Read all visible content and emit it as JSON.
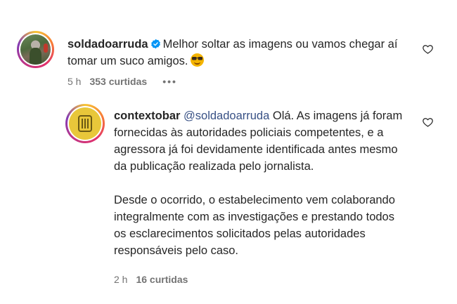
{
  "comments": [
    {
      "username": "soldadoarruda",
      "verified": true,
      "text": "Melhor soltar as imagens ou vamos chegar aí tomar um suco amigos.",
      "emoji": "sunglasses-emoji",
      "time": "5 h",
      "likes": "353 curtidas",
      "more": "•••"
    },
    {
      "username": "contextobar",
      "mention": "@soldadoarruda",
      "paragraph1": "Olá. As imagens já foram fornecidas às autoridades policiais competentes, e a agressora já foi devidamente identificada antes mesmo da publicação realizada pelo jornalista.",
      "paragraph2": "Desde o ocorrido, o estabelecimento vem colaborando integralmente com as investigações e prestando todos os esclarecimentos solicitados pelas autoridades responsáveis pelo caso.",
      "time": "2 h",
      "likes": "16 curtidas"
    }
  ],
  "colors": {
    "verified": "#0095f6",
    "mention": "#385185",
    "meta": "#737373"
  }
}
